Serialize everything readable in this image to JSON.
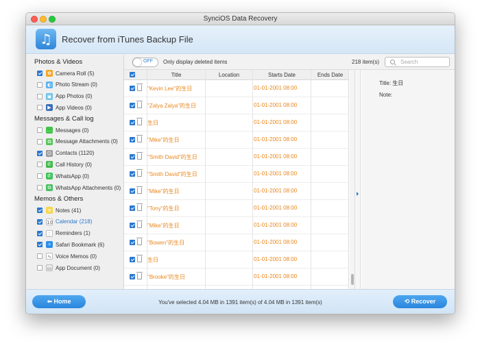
{
  "window": {
    "title": "SynciOS Data Recovery"
  },
  "colors": {
    "accent": "#2b78cf",
    "orange": "#e8861c",
    "close": "#fc5f57",
    "minimize": "#fdbc2e",
    "zoom": "#28c840"
  },
  "header": {
    "title": "Recover from iTunes Backup File",
    "icon": "music-note-icon"
  },
  "sidebar": {
    "groups": [
      {
        "label": "Photos & Videos",
        "items": [
          {
            "label": "Camera Roll (5)",
            "checked": true,
            "icon": "camera-roll-icon",
            "selected": false
          },
          {
            "label": "Photo Stream (0)",
            "checked": false,
            "icon": "photo-stream-icon",
            "selected": false
          },
          {
            "label": "App Photos (0)",
            "checked": false,
            "icon": "app-photos-icon",
            "selected": false
          },
          {
            "label": "App Videos (0)",
            "checked": false,
            "icon": "app-videos-icon",
            "selected": false
          }
        ]
      },
      {
        "label": "Messages & Call log",
        "items": [
          {
            "label": "Messages (0)",
            "checked": false,
            "icon": "messages-icon",
            "selected": false
          },
          {
            "label": "Message Attachments (0)",
            "checked": false,
            "icon": "message-attachments-icon",
            "selected": false
          },
          {
            "label": "Contacts (1120)",
            "checked": true,
            "icon": "contacts-icon",
            "selected": false
          },
          {
            "label": "Call History (0)",
            "checked": false,
            "icon": "call-history-icon",
            "selected": false
          },
          {
            "label": "WhatsApp (0)",
            "checked": false,
            "icon": "whatsapp-icon",
            "selected": false
          },
          {
            "label": "WhatsApp Attachments (0)",
            "checked": false,
            "icon": "whatsapp-attachments-icon",
            "selected": false
          }
        ]
      },
      {
        "label": "Memos & Others",
        "items": [
          {
            "label": "Notes (41)",
            "checked": true,
            "icon": "notes-icon",
            "selected": false
          },
          {
            "label": "Calendar (218)",
            "checked": true,
            "icon": "calendar-icon",
            "selected": true
          },
          {
            "label": "Reminders (1)",
            "checked": true,
            "icon": "reminders-icon",
            "selected": false
          },
          {
            "label": "Safari Bookmark (6)",
            "checked": true,
            "icon": "safari-bookmark-icon",
            "selected": false
          },
          {
            "label": "Voice Memos (0)",
            "checked": false,
            "icon": "voice-memos-icon",
            "selected": false
          },
          {
            "label": "App Document (0)",
            "checked": false,
            "icon": "app-document-icon",
            "selected": false
          }
        ]
      }
    ]
  },
  "toolbar": {
    "toggle_label": "OFF",
    "only_deleted_label": "Only display deleted items",
    "item_count": "218 item(s)",
    "search_placeholder": "Search"
  },
  "table": {
    "columns": [
      "Title",
      "Location",
      "Starts Date",
      "Ends Date"
    ],
    "rows": [
      {
        "title": "\"Kevin Lee\"的生日",
        "location": "",
        "starts": "01-01-2001 08:00",
        "ends": ""
      },
      {
        "title": "\"Zalya Zalya\"的生日",
        "location": "",
        "starts": "01-01-2001 08:00",
        "ends": ""
      },
      {
        "title": "生日",
        "location": "",
        "starts": "01-01-2001 08:00",
        "ends": ""
      },
      {
        "title": "\"Mike\"的生日",
        "location": "",
        "starts": "01-01-2001 08:00",
        "ends": ""
      },
      {
        "title": "\"Smith David\"的生日",
        "location": "",
        "starts": "01-01-2001 08:00",
        "ends": ""
      },
      {
        "title": "\"Smith David\"的生日",
        "location": "",
        "starts": "01-01-2001 08:00",
        "ends": ""
      },
      {
        "title": "\"Mike\"的生日",
        "location": "",
        "starts": "01-01-2001 08:00",
        "ends": ""
      },
      {
        "title": "\"Tony\"的生日",
        "location": "",
        "starts": "01-01-2001 08:00",
        "ends": ""
      },
      {
        "title": "\"Mike\"的生日",
        "location": "",
        "starts": "01-01-2001 08:00",
        "ends": ""
      },
      {
        "title": "\"Bowen\"的生日",
        "location": "",
        "starts": "01-01-2001 08:00",
        "ends": ""
      },
      {
        "title": "生日",
        "location": "",
        "starts": "01-01-2001 08:00",
        "ends": ""
      },
      {
        "title": "\"Brooke\"的生日",
        "location": "",
        "starts": "01-01-2001 08:00",
        "ends": ""
      }
    ]
  },
  "detail": {
    "title_line": "Title:  生日",
    "note_line": "Note:"
  },
  "footer": {
    "home_label": "Home",
    "recover_label": "Recover",
    "status": "You've selected 4.04 MB in 1391 item(s) of 4.04 MB in 1391 item(s)"
  }
}
